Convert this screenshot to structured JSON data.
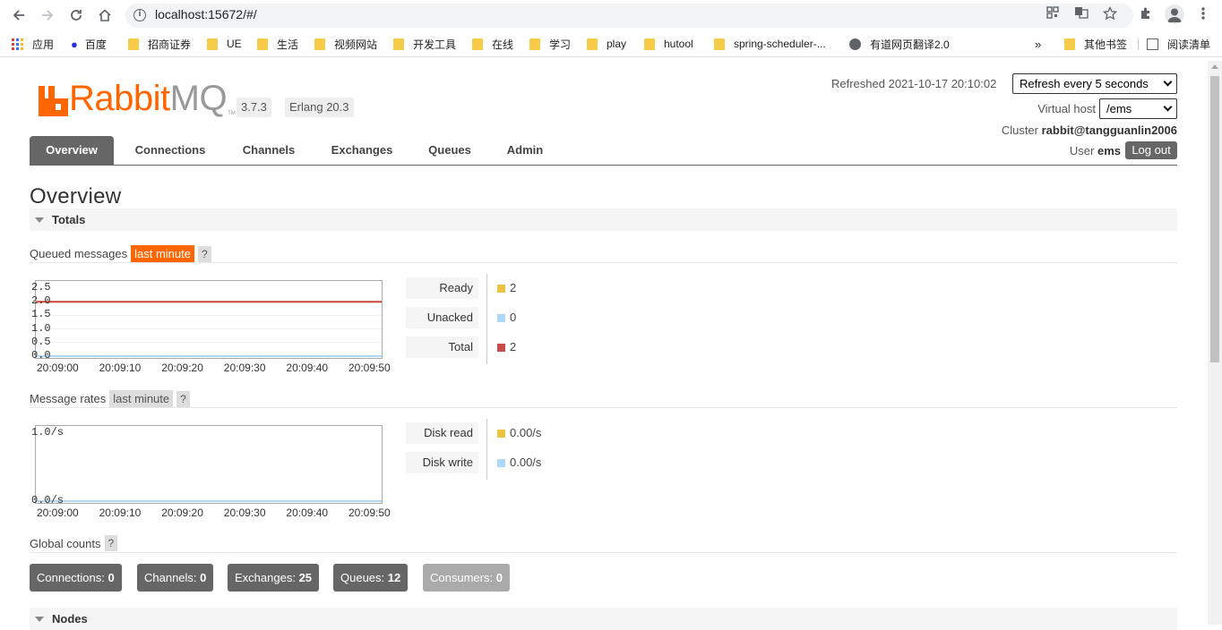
{
  "browser": {
    "url": "localhost:15672/#/",
    "bookmarks": [
      {
        "label": "应用"
      },
      {
        "label": "百度"
      },
      {
        "label": "招商证券"
      },
      {
        "label": "UE"
      },
      {
        "label": "生活"
      },
      {
        "label": "视频网站"
      },
      {
        "label": "开发工具"
      },
      {
        "label": "在线"
      },
      {
        "label": "学习"
      },
      {
        "label": "play"
      },
      {
        "label": "hutool"
      },
      {
        "label": "spring-scheduler-..."
      },
      {
        "label": "有道网页翻译2.0"
      },
      {
        "label": "»"
      },
      {
        "label": "其他书签"
      },
      {
        "label": "阅读清单"
      }
    ]
  },
  "header": {
    "logo_rabbit": "Rabbit",
    "logo_mq": "MQ",
    "logo_tm": "TM",
    "version": "3.7.3",
    "erlang": "Erlang 20.3",
    "refreshed": "Refreshed 2021-10-17 20:10:02",
    "refresh_select": "Refresh every 5 seconds",
    "vhost_label": "Virtual host",
    "vhost_select": "/ems",
    "cluster_label": "Cluster",
    "cluster_name": "rabbit@tangguanlin2006",
    "user_label": "User",
    "user_name": "ems",
    "logout": "Log out"
  },
  "tabs": [
    "Overview",
    "Connections",
    "Channels",
    "Exchanges",
    "Queues",
    "Admin"
  ],
  "page_title": "Overview",
  "totals": {
    "heading": "Totals",
    "queued_label": "Queued messages",
    "queued_range": "last minute",
    "help": "?",
    "rates_label": "Message rates",
    "rates_range": "last minute",
    "global_label": "Global counts"
  },
  "nodes_heading": "Nodes",
  "queued_legend": [
    {
      "label": "Ready",
      "value": "2",
      "color": "#edc240"
    },
    {
      "label": "Unacked",
      "value": "0",
      "color": "#afd8f8"
    },
    {
      "label": "Total",
      "value": "2",
      "color": "#cb4b4b"
    }
  ],
  "rates_legend": [
    {
      "label": "Disk read",
      "value": "0.00/s",
      "color": "#edc240"
    },
    {
      "label": "Disk write",
      "value": "0.00/s",
      "color": "#afd8f8"
    }
  ],
  "counts": [
    {
      "label": "Connections:",
      "value": "0"
    },
    {
      "label": "Channels:",
      "value": "0"
    },
    {
      "label": "Exchanges:",
      "value": "25"
    },
    {
      "label": "Queues:",
      "value": "12"
    },
    {
      "label": "Consumers:",
      "value": "0"
    }
  ],
  "chart_data": [
    {
      "type": "line",
      "x": [
        "20:09:00",
        "20:09:10",
        "20:09:20",
        "20:09:30",
        "20:09:40",
        "20:09:50"
      ],
      "yticks": [
        "2.5",
        "2.0",
        "1.5",
        "1.0",
        "0.5",
        "0.0"
      ],
      "ylim": [
        0,
        2.5
      ],
      "series": [
        {
          "name": "Ready",
          "color": "#edc240",
          "values": [
            2,
            2,
            2,
            2,
            2,
            2
          ]
        },
        {
          "name": "Unacked",
          "color": "#afd8f8",
          "values": [
            0,
            0,
            0,
            0,
            0,
            0
          ]
        },
        {
          "name": "Total",
          "color": "#cb4b4b",
          "values": [
            2,
            2,
            2,
            2,
            2,
            2
          ]
        }
      ]
    },
    {
      "type": "line",
      "x": [
        "20:09:00",
        "20:09:10",
        "20:09:20",
        "20:09:30",
        "20:09:40",
        "20:09:50"
      ],
      "yticks": [
        "1.0/s",
        "0.0/s"
      ],
      "ylim": [
        0,
        1.0
      ],
      "series": [
        {
          "name": "Disk read",
          "color": "#edc240",
          "values": [
            0,
            0,
            0,
            0,
            0,
            0
          ]
        },
        {
          "name": "Disk write",
          "color": "#afd8f8",
          "values": [
            0,
            0,
            0,
            0,
            0,
            0
          ]
        }
      ]
    }
  ]
}
